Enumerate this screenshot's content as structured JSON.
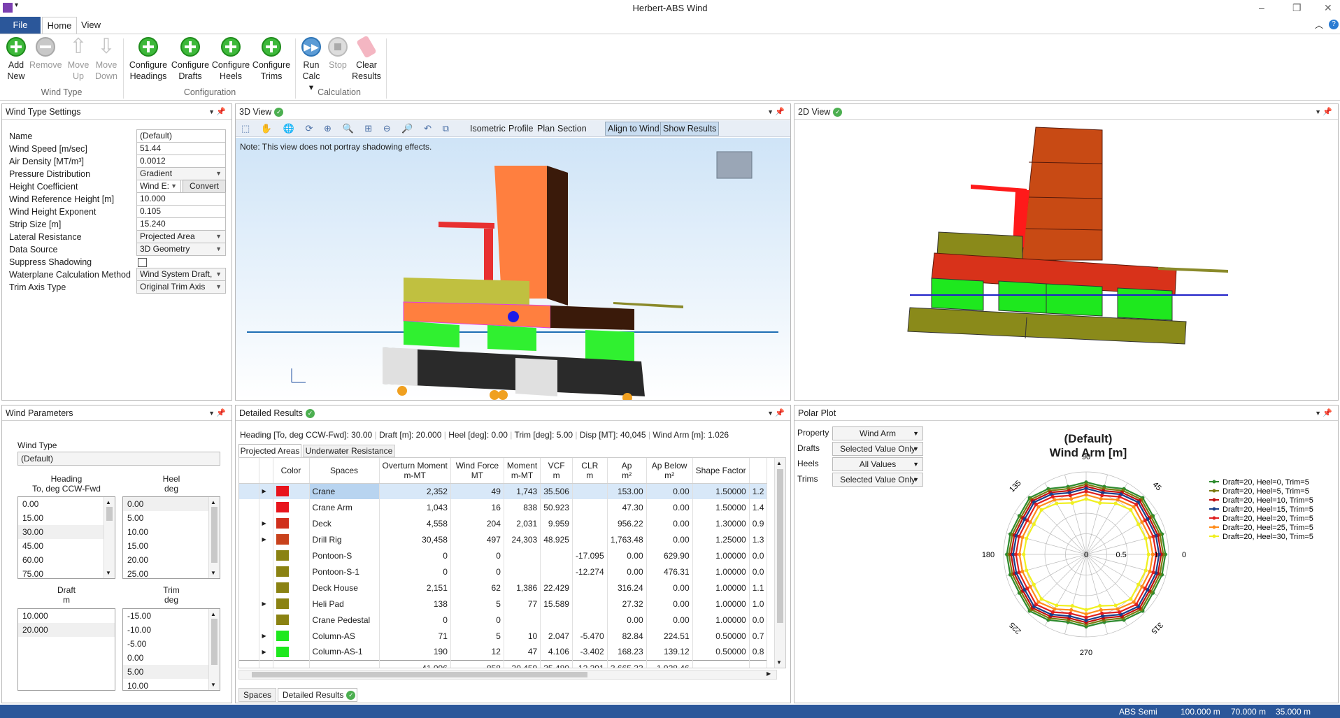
{
  "app": {
    "title": "Herbert-ABS Wind"
  },
  "menu": {
    "file": "File",
    "home": "Home",
    "view": "View"
  },
  "ribbon": {
    "buttons": [
      {
        "l1": "Add",
        "l2": "New"
      },
      {
        "l1": "Remove",
        "l2": ""
      },
      {
        "l1": "Move",
        "l2": "Up"
      },
      {
        "l1": "Move",
        "l2": "Down"
      },
      {
        "l1": "Configure",
        "l2": "Headings"
      },
      {
        "l1": "Configure",
        "l2": "Drafts"
      },
      {
        "l1": "Configure",
        "l2": "Heels"
      },
      {
        "l1": "Configure",
        "l2": "Trims"
      },
      {
        "l1": "Run",
        "l2": "Calc ▾"
      },
      {
        "l1": "Stop",
        "l2": ""
      },
      {
        "l1": "Clear",
        "l2": "Results"
      }
    ],
    "groups": {
      "wind_type": "Wind Type",
      "configuration": "Configuration",
      "calculation": "Calculation"
    }
  },
  "wind_type_settings": {
    "title": "Wind Type Settings",
    "rows": [
      {
        "label": "Name",
        "value": "(Default)"
      },
      {
        "label": "Wind Speed [m/sec]",
        "value": "51.44"
      },
      {
        "label": "Air Density [MT/m³]",
        "value": "0.0012"
      },
      {
        "label": "Pressure Distribution",
        "value": "Gradient"
      },
      {
        "label": "Height Coefficient",
        "value": "Wind E:"
      },
      {
        "label": "Wind Reference Height [m]",
        "value": "10.000"
      },
      {
        "label": "Wind Height Exponent",
        "value": "0.105"
      },
      {
        "label": "Strip Size [m]",
        "value": "15.240"
      },
      {
        "label": "Lateral Resistance",
        "value": "Projected Area"
      },
      {
        "label": "Data Source",
        "value": "3D Geometry"
      },
      {
        "label": "Suppress Shadowing",
        "value": ""
      },
      {
        "label": "Waterplane Calculation Method",
        "value": "Wind System Draft,"
      },
      {
        "label": "Trim Axis Type",
        "value": "Original Trim Axis"
      }
    ],
    "convert": "Convert"
  },
  "view3d": {
    "title": "3D View",
    "toolbar": [
      "Isometric",
      "Profile",
      "Plan",
      "Section",
      "Align to Wind",
      "Show Results"
    ],
    "note": "Note: This view does not portray shadowing effects."
  },
  "view2d": {
    "title": "2D View"
  },
  "wind_params": {
    "title": "Wind Parameters",
    "wind_type_label": "Wind Type",
    "wind_type_value": "(Default)",
    "heading_h1": "Heading",
    "heading_h2": "To, deg CCW-Fwd",
    "heel_h1": "Heel",
    "heel_h2": "deg",
    "draft_h1": "Draft",
    "draft_h2": "m",
    "trim_h1": "Trim",
    "trim_h2": "deg",
    "headings": [
      "0.00",
      "15.00",
      "30.00",
      "45.00",
      "60.00",
      "75.00"
    ],
    "heels": [
      "0.00",
      "5.00",
      "10.00",
      "15.00",
      "20.00",
      "25.00"
    ],
    "drafts": [
      "10.000",
      "20.000"
    ],
    "trims": [
      "-15.00",
      "-10.00",
      "-5.00",
      "0.00",
      "5.00",
      "10.00"
    ]
  },
  "results": {
    "title": "Detailed Results",
    "summary": [
      "Heading [To, deg CCW-Fwd]: 30.00",
      "Draft [m]: 20.000",
      "Heel [deg]: 0.00",
      "Trim [deg]: 5.00",
      "Disp [MT]: 40,045",
      "Wind Arm [m]: 1.026"
    ],
    "tabs": [
      "Projected Areas",
      "Underwater Resistance"
    ],
    "columns": [
      {
        "h1": "Color",
        "h2": ""
      },
      {
        "h1": "Spaces",
        "h2": ""
      },
      {
        "h1": "Overturn Moment",
        "h2": "m-MT"
      },
      {
        "h1": "Wind Force",
        "h2": "MT"
      },
      {
        "h1": "Moment",
        "h2": "m-MT"
      },
      {
        "h1": "VCF",
        "h2": "m"
      },
      {
        "h1": "CLR",
        "h2": "m"
      },
      {
        "h1": "Ap",
        "h2": "m²"
      },
      {
        "h1": "Ap Below",
        "h2": "m²"
      },
      {
        "h1": "Shape Factor",
        "h2": ""
      }
    ],
    "rows": [
      {
        "exp": "▶",
        "color": "#e8141c",
        "name": "Crane",
        "om": "2,352",
        "wf": "49",
        "mo": "1,743",
        "vcf": "35.506",
        "clr": "",
        "ap": "153.00",
        "apb": "0.00",
        "sf": "1.50000",
        "x": "1.2"
      },
      {
        "exp": "",
        "color": "#e8141c",
        "name": "Crane Arm",
        "om": "1,043",
        "wf": "16",
        "mo": "838",
        "vcf": "50.923",
        "clr": "",
        "ap": "47.30",
        "apb": "0.00",
        "sf": "1.50000",
        "x": "1.4"
      },
      {
        "exp": "▶",
        "color": "#d0301c",
        "name": "Deck",
        "om": "4,558",
        "wf": "204",
        "mo": "2,031",
        "vcf": "9.959",
        "clr": "",
        "ap": "956.22",
        "apb": "0.00",
        "sf": "1.30000",
        "x": "0.9"
      },
      {
        "exp": "▶",
        "color": "#c8421c",
        "name": "Drill Rig",
        "om": "30,458",
        "wf": "497",
        "mo": "24,303",
        "vcf": "48.925",
        "clr": "",
        "ap": "1,763.48",
        "apb": "0.00",
        "sf": "1.25000",
        "x": "1.3"
      },
      {
        "exp": "",
        "color": "#8a8212",
        "name": "Pontoon-S",
        "om": "0",
        "wf": "0",
        "mo": "",
        "vcf": "",
        "clr": "-17.095",
        "ap": "0.00",
        "apb": "629.90",
        "sf": "1.00000",
        "x": "0.0"
      },
      {
        "exp": "",
        "color": "#8a8212",
        "name": "Pontoon-S-1",
        "om": "0",
        "wf": "0",
        "mo": "",
        "vcf": "",
        "clr": "-12.274",
        "ap": "0.00",
        "apb": "476.31",
        "sf": "1.00000",
        "x": "0.0"
      },
      {
        "exp": "",
        "color": "#8a8212",
        "name": "Deck House",
        "om": "2,151",
        "wf": "62",
        "mo": "1,386",
        "vcf": "22.429",
        "clr": "",
        "ap": "316.24",
        "apb": "0.00",
        "sf": "1.00000",
        "x": "1.1"
      },
      {
        "exp": "▶",
        "color": "#8a8212",
        "name": "Heli Pad",
        "om": "138",
        "wf": "5",
        "mo": "77",
        "vcf": "15.589",
        "clr": "",
        "ap": "27.32",
        "apb": "0.00",
        "sf": "1.00000",
        "x": "1.0"
      },
      {
        "exp": "",
        "color": "#8a8212",
        "name": "Crane Pedestal",
        "om": "0",
        "wf": "0",
        "mo": "",
        "vcf": "",
        "clr": "",
        "ap": "0.00",
        "apb": "0.00",
        "sf": "1.00000",
        "x": "0.0"
      },
      {
        "exp": "▶",
        "color": "#1ee81e",
        "name": "Column-AS",
        "om": "71",
        "wf": "5",
        "mo": "10",
        "vcf": "2.047",
        "clr": "-5.470",
        "ap": "82.84",
        "apb": "224.51",
        "sf": "0.50000",
        "x": "0.7"
      },
      {
        "exp": "▶",
        "color": "#1ee81e",
        "name": "Column-AS-1",
        "om": "190",
        "wf": "12",
        "mo": "47",
        "vcf": "4.106",
        "clr": "-3.402",
        "ap": "168.23",
        "apb": "139.12",
        "sf": "0.50000",
        "x": "0.8"
      }
    ],
    "totals": {
      "om": "41,096",
      "wf": "858",
      "mo": "30,459",
      "vcf": "35.480",
      "clr": "-12.391",
      "ap": "3,665.33",
      "apb": "1,928.46"
    },
    "bottom_tabs": [
      "Spaces",
      "Detailed Results"
    ]
  },
  "polar": {
    "title": "Polar Plot",
    "props": [
      {
        "label": "Property",
        "value": "Wind Arm"
      },
      {
        "label": "Drafts",
        "value": "Selected Value Only"
      },
      {
        "label": "Heels",
        "value": "All Values"
      },
      {
        "label": "Trims",
        "value": "Selected Value Only"
      }
    ],
    "chart_title1": "(Default)",
    "chart_title2": "Wind Arm [m]",
    "angle_labels": [
      "90",
      "45",
      "0",
      "315",
      "270",
      "225",
      "180",
      "135"
    ],
    "radial_labels": [
      "0",
      "0.5",
      "1"
    ],
    "legend": [
      {
        "name": "Draft=20, Heel=0, Trim=5",
        "color": "#2e8b2e"
      },
      {
        "name": "Draft=20, Heel=5, Trim=5",
        "color": "#7a7a10"
      },
      {
        "name": "Draft=20, Heel=10, Trim=5",
        "color": "#c01010"
      },
      {
        "name": "Draft=20, Heel=15, Trim=5",
        "color": "#1a3f8a"
      },
      {
        "name": "Draft=20, Heel=20, Trim=5",
        "color": "#e02020"
      },
      {
        "name": "Draft=20, Heel=25, Trim=5",
        "color": "#ff8c1a"
      },
      {
        "name": "Draft=20, Heel=30, Trim=5",
        "color": "#f0f020"
      }
    ]
  },
  "chart_data": {
    "type": "line",
    "title": "(Default) Wind Arm [m]",
    "x": [
      0,
      15,
      30,
      45,
      60,
      75,
      90,
      105,
      120,
      135,
      150,
      165,
      180,
      195,
      210,
      225,
      240,
      255,
      270,
      285,
      300,
      315,
      330,
      345
    ],
    "rlim": [
      0,
      1.2
    ],
    "series": [
      {
        "name": "Draft=20, Heel=0, Trim=5",
        "values": [
          1.13,
          1.12,
          1.1,
          1.14,
          1.08,
          1.0,
          1.03,
          1.0,
          1.08,
          1.14,
          1.1,
          1.12,
          1.13,
          1.12,
          1.1,
          1.14,
          1.08,
          1.0,
          1.03,
          1.0,
          1.08,
          1.14,
          1.1,
          1.12
        ]
      },
      {
        "name": "Draft=20, Heel=5, Trim=5",
        "values": [
          1.1,
          1.09,
          1.07,
          1.11,
          1.05,
          0.97,
          1.0,
          0.97,
          1.05,
          1.11,
          1.07,
          1.09,
          1.1,
          1.09,
          1.07,
          1.11,
          1.05,
          0.97,
          1.0,
          0.97,
          1.05,
          1.11,
          1.07,
          1.09
        ]
      },
      {
        "name": "Draft=20, Heel=10, Trim=5",
        "values": [
          1.07,
          1.06,
          1.04,
          1.08,
          1.02,
          0.94,
          0.97,
          0.94,
          1.02,
          1.08,
          1.04,
          1.06,
          1.07,
          1.06,
          1.04,
          1.08,
          1.02,
          0.94,
          0.97,
          0.94,
          1.02,
          1.08,
          1.04,
          1.06
        ]
      },
      {
        "name": "Draft=20, Heel=15, Trim=5",
        "values": [
          1.04,
          1.03,
          1.01,
          1.05,
          0.99,
          0.91,
          0.94,
          0.91,
          0.99,
          1.05,
          1.01,
          1.03,
          1.04,
          1.03,
          1.01,
          1.05,
          0.99,
          0.91,
          0.94,
          0.91,
          0.99,
          1.05,
          1.01,
          1.03
        ]
      },
      {
        "name": "Draft=20, Heel=20, Trim=5",
        "values": [
          1.0,
          0.99,
          0.97,
          1.01,
          0.95,
          0.87,
          0.9,
          0.87,
          0.95,
          1.01,
          0.97,
          0.99,
          1.0,
          0.99,
          0.97,
          1.01,
          0.95,
          0.87,
          0.9,
          0.87,
          0.95,
          1.01,
          0.97,
          0.99
        ]
      },
      {
        "name": "Draft=20, Heel=25, Trim=5",
        "values": [
          0.95,
          0.94,
          0.92,
          0.96,
          0.9,
          0.82,
          0.85,
          0.82,
          0.9,
          0.96,
          0.92,
          0.94,
          0.95,
          0.94,
          0.92,
          0.96,
          0.9,
          0.82,
          0.85,
          0.82,
          0.9,
          0.96,
          0.92,
          0.94
        ]
      },
      {
        "name": "Draft=20, Heel=30, Trim=5",
        "values": [
          0.89,
          0.88,
          0.86,
          0.9,
          0.84,
          0.76,
          0.79,
          0.76,
          0.84,
          0.9,
          0.86,
          0.88,
          0.89,
          0.88,
          0.86,
          0.9,
          0.84,
          0.76,
          0.79,
          0.76,
          0.84,
          0.9,
          0.86,
          0.88
        ]
      }
    ]
  },
  "status": {
    "s1": "ABS Semi",
    "s2": "100.000 m",
    "s3": "70.000 m",
    "s4": "35.000 m"
  }
}
